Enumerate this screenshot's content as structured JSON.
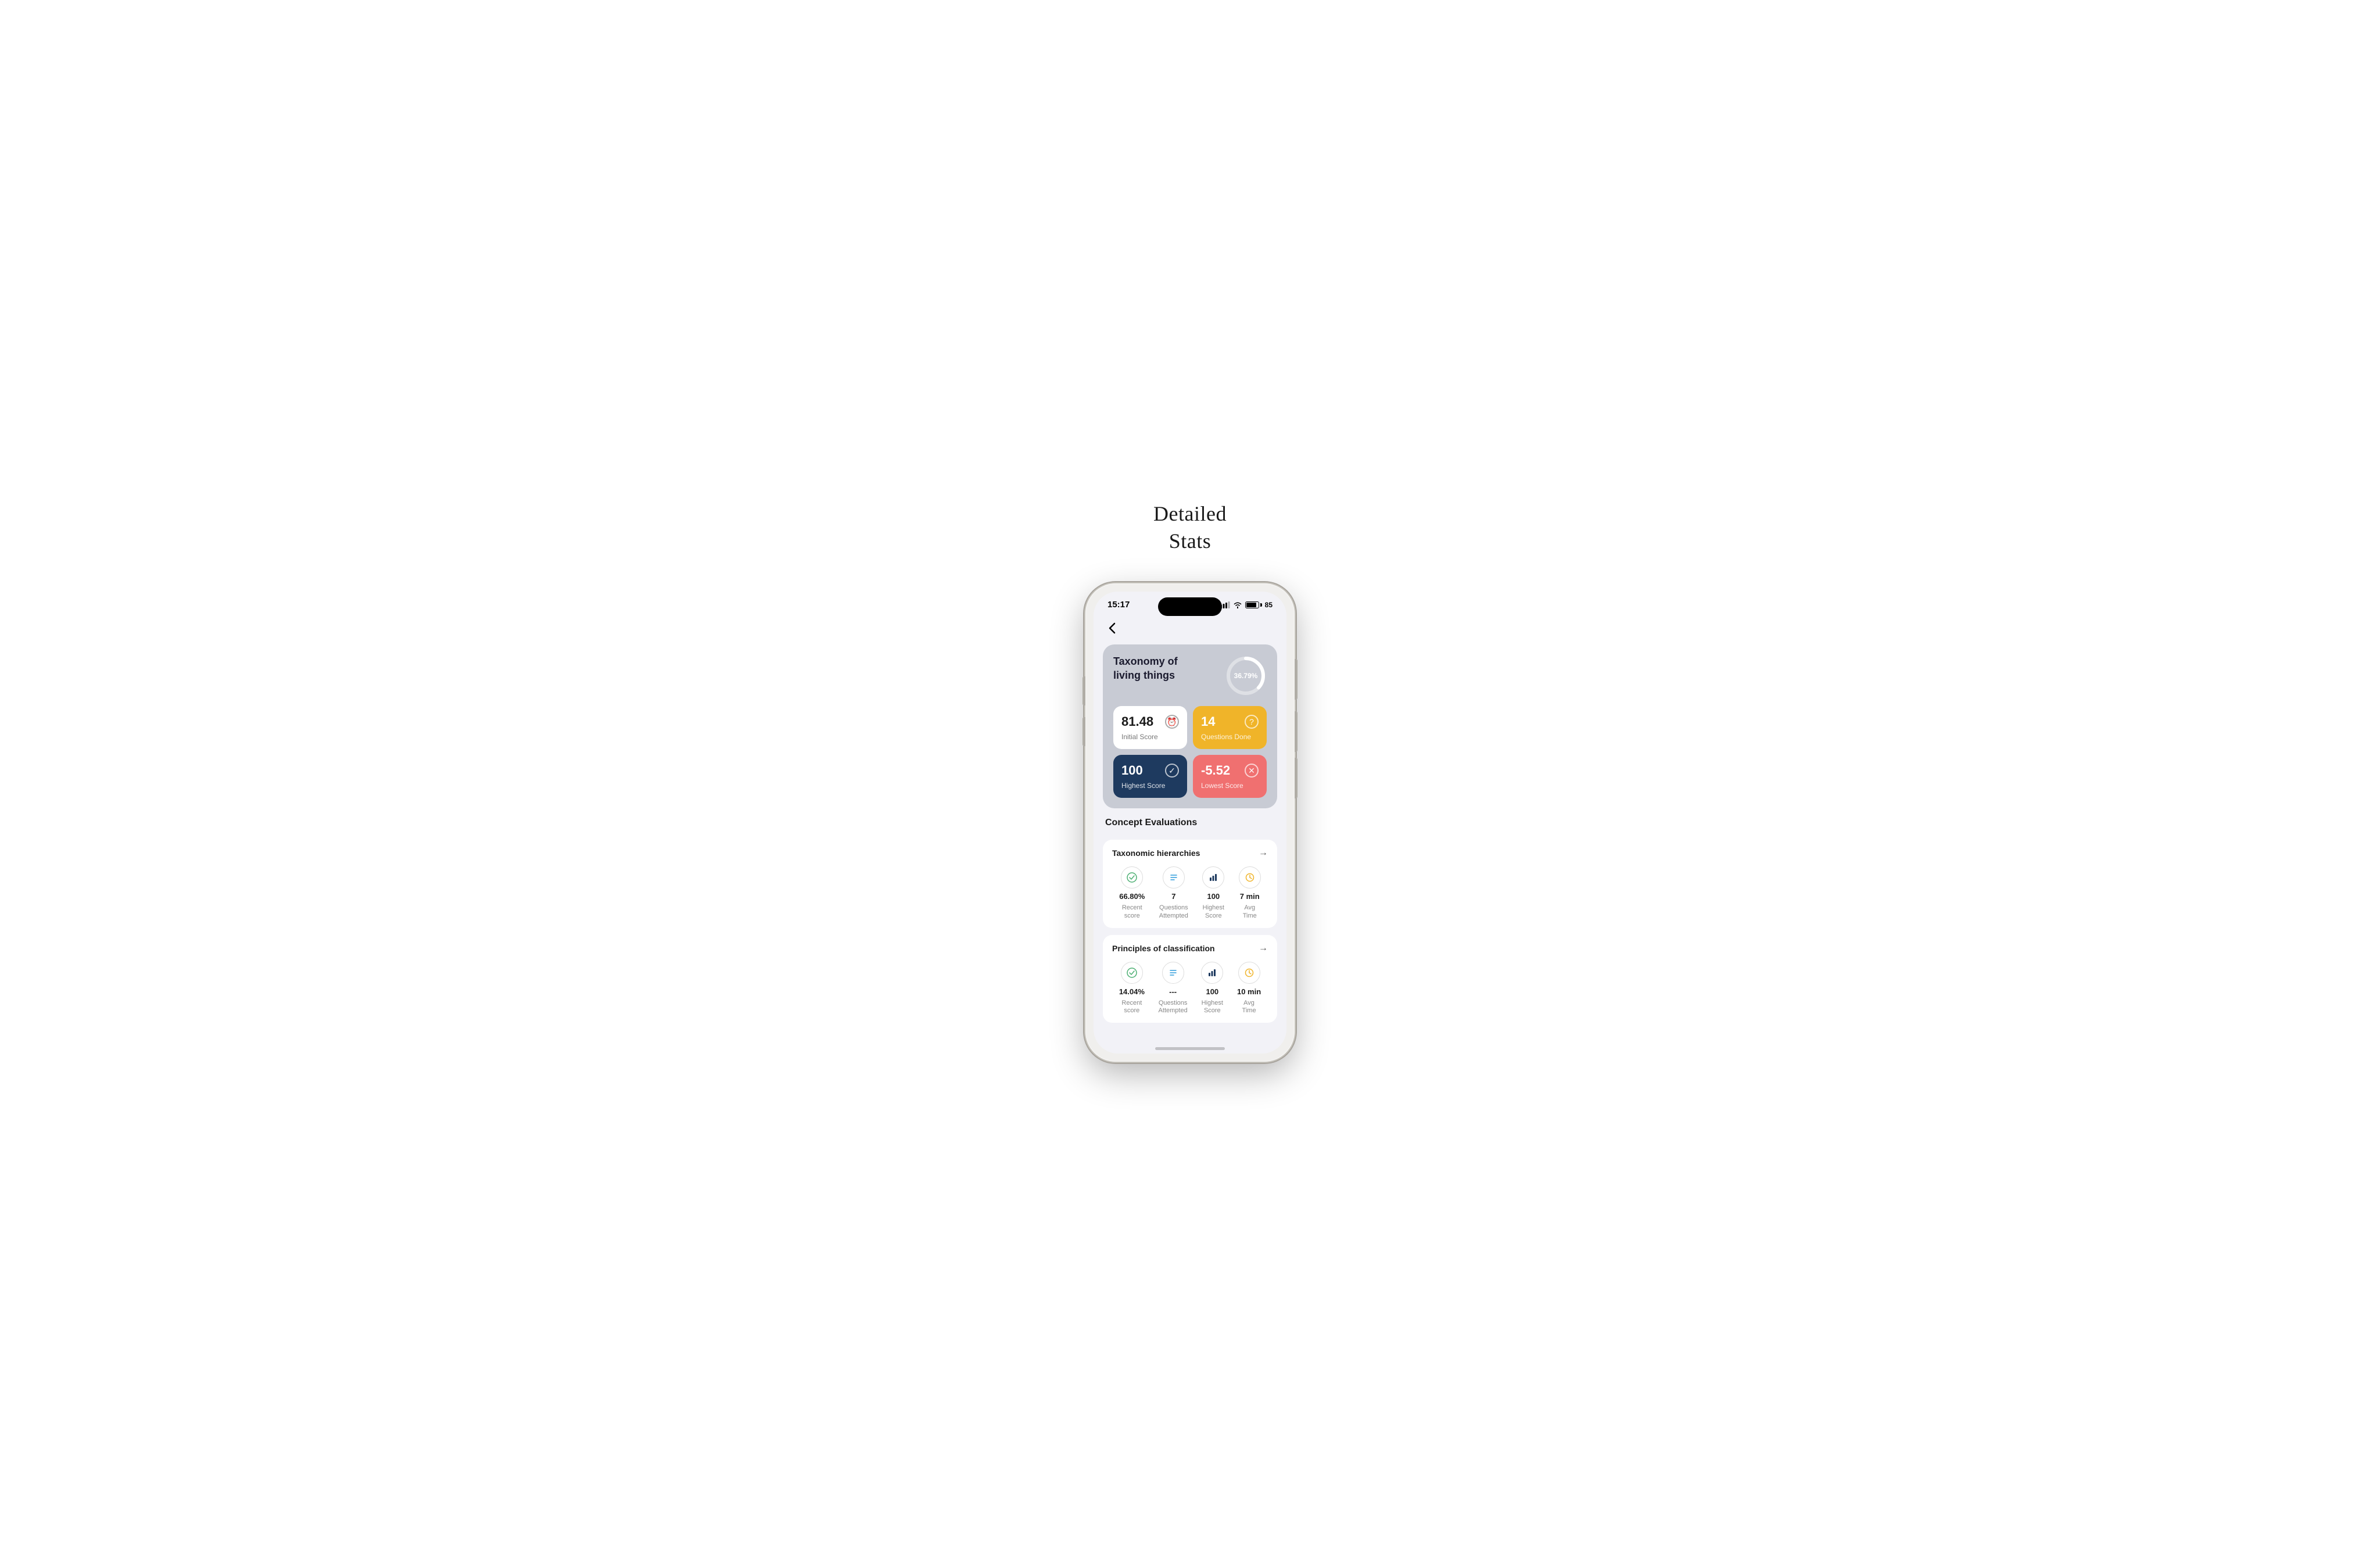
{
  "page": {
    "title_line1": "Detailed",
    "title_line2": "Stats"
  },
  "status_bar": {
    "time": "15:17",
    "battery_percent": "85"
  },
  "nav": {
    "back_label": "back"
  },
  "main_card": {
    "topic_title": "Taxonomy of living things",
    "percentage": "36.79%",
    "progress_value": 36.79,
    "stats": [
      {
        "id": "initial_score",
        "value": "81.48",
        "label": "Initial Score",
        "theme": "white",
        "icon": "clock"
      },
      {
        "id": "questions_done",
        "value": "14",
        "label": "Questions Done",
        "theme": "yellow",
        "icon": "question"
      },
      {
        "id": "highest_score",
        "value": "100",
        "label": "Highest Score",
        "theme": "dark-blue",
        "icon": "check-circle"
      },
      {
        "id": "lowest_score",
        "value": "-5.52",
        "label": "Lowest Score",
        "theme": "red",
        "icon": "x-circle"
      }
    ]
  },
  "concept_evaluations": {
    "section_title": "Concept Evaluations",
    "concepts": [
      {
        "id": "taxonomic_hierarchies",
        "name": "Taxonomic hierarchies",
        "stats": [
          {
            "icon": "check-circle",
            "icon_type": "green",
            "value": "66.80%",
            "label": "Recent\nscore"
          },
          {
            "icon": "list",
            "icon_type": "teal",
            "value": "7",
            "label": "Questions\nAttempted"
          },
          {
            "icon": "bar-chart",
            "icon_type": "navy",
            "value": "100",
            "label": "Highest\nScore"
          },
          {
            "icon": "clock",
            "icon_type": "orange",
            "value": "7 min",
            "label": "Avg\nTime"
          }
        ]
      },
      {
        "id": "principles_of_classification",
        "name": "Principles of classification",
        "stats": [
          {
            "icon": "check-circle",
            "icon_type": "green",
            "value": "14.04%",
            "label": "Recent\nscore"
          },
          {
            "icon": "list",
            "icon_type": "teal",
            "value": "---",
            "label": "Questions\nAttempted"
          },
          {
            "icon": "bar-chart",
            "icon_type": "navy",
            "value": "100",
            "label": "Highest\nScore"
          },
          {
            "icon": "clock",
            "icon_type": "orange",
            "value": "10 min",
            "label": "Avg\nTime"
          }
        ]
      }
    ]
  }
}
